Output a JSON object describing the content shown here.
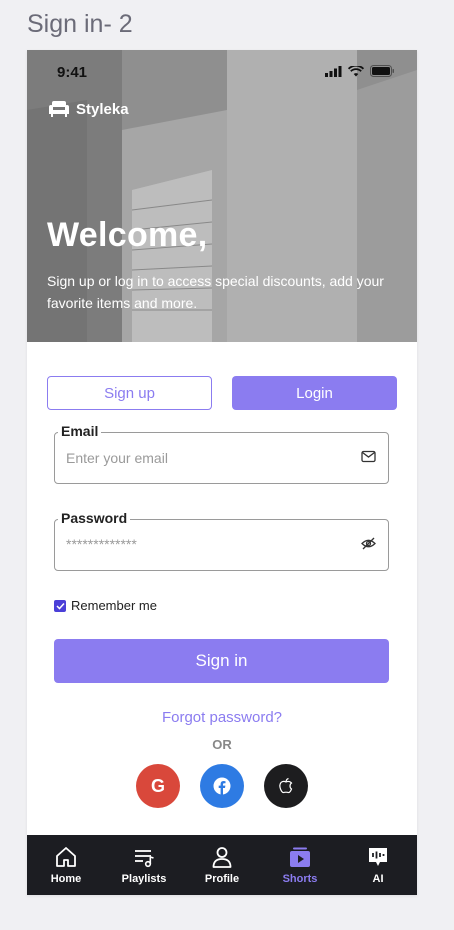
{
  "frame_title": "Sign in- 2",
  "status_bar": {
    "time": "9:41"
  },
  "brand": {
    "name": "Styleka"
  },
  "hero": {
    "title": "Welcome,",
    "subtitle": "Sign up or log in to access special discounts, add your favorite items and more."
  },
  "tabs": {
    "signup": "Sign up",
    "login": "Login"
  },
  "email": {
    "label": "Email",
    "placeholder": "Enter your email"
  },
  "password": {
    "label": "Password",
    "value": "*************"
  },
  "remember": {
    "label": "Remember me",
    "checked": true
  },
  "signin_button": "Sign in",
  "forgot_password": "Forgot password?",
  "or_text": "OR",
  "social": {
    "google": "G"
  },
  "nav": {
    "items": [
      {
        "label": "Home",
        "icon": "home-icon"
      },
      {
        "label": "Playlists",
        "icon": "playlists-icon"
      },
      {
        "label": "Profile",
        "icon": "profile-icon"
      },
      {
        "label": "Shorts",
        "icon": "shorts-icon"
      },
      {
        "label": "AI",
        "icon": "ai-icon"
      }
    ]
  },
  "colors": {
    "accent": "#8b7cf0",
    "nav_bg": "#1c1d22",
    "google": "#d9483b",
    "facebook": "#2e7be3",
    "apple": "#1d1d1f"
  }
}
